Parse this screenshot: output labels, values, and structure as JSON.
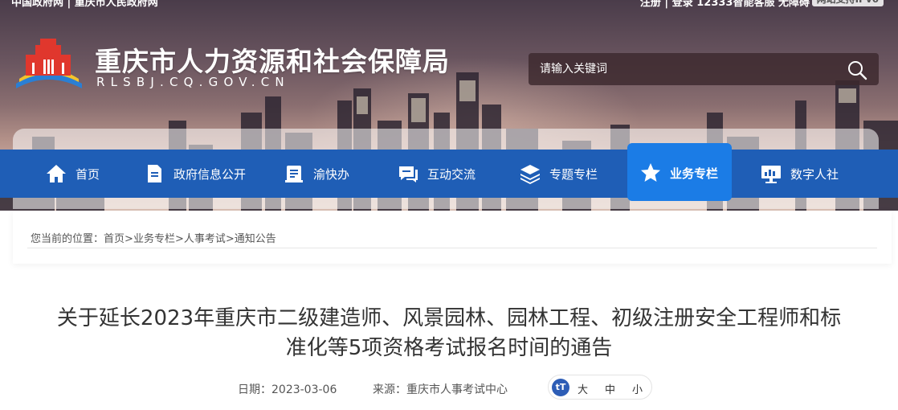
{
  "topbar": {
    "left_text": "中国政府网 | 重庆市人民政府网",
    "right_text": "注册 | 登录   12333智能客服   无障碍",
    "ipv6_badge": "网站支持IPv6"
  },
  "site": {
    "name": "重庆市人力资源和社会保障局",
    "domain": "RLSBJ.CQ.GOV.CN"
  },
  "search": {
    "placeholder": "请输入关键词",
    "icon": "search-icon"
  },
  "nav": {
    "items": [
      {
        "label": "首页",
        "icon": "home-icon"
      },
      {
        "label": "政府信息公开",
        "icon": "document-icon"
      },
      {
        "label": "渝快办",
        "icon": "service-icon"
      },
      {
        "label": "互动交流",
        "icon": "chat-icon"
      },
      {
        "label": "专题专栏",
        "icon": "layers-icon"
      },
      {
        "label": "业务专栏",
        "icon": "star-icon"
      },
      {
        "label": "数字人社",
        "icon": "monitor-icon"
      }
    ],
    "active": "业务专栏"
  },
  "breadcrumb": {
    "prefix": "您当前的位置：",
    "items": [
      "首页",
      "业务专栏",
      "人事考试",
      "通知公告"
    ],
    "separator": ">"
  },
  "article": {
    "title_line1": "关于延长2023年重庆市二级建造师、风景园林、园林工程、初级注册安全工程师和标",
    "title_line2": "准化等5项资格考试报名时间的通告",
    "date_label": "日期：",
    "date": "2023-03-06",
    "source_label": "来源：",
    "source": "重庆市人事考试中心",
    "font_size": {
      "icon_text": "tT",
      "options": [
        "大",
        "中",
        "小"
      ]
    }
  },
  "colors": {
    "nav_bg": "#1f5eb6",
    "nav_active": "#1b7ce6",
    "title_text": "#333333"
  }
}
